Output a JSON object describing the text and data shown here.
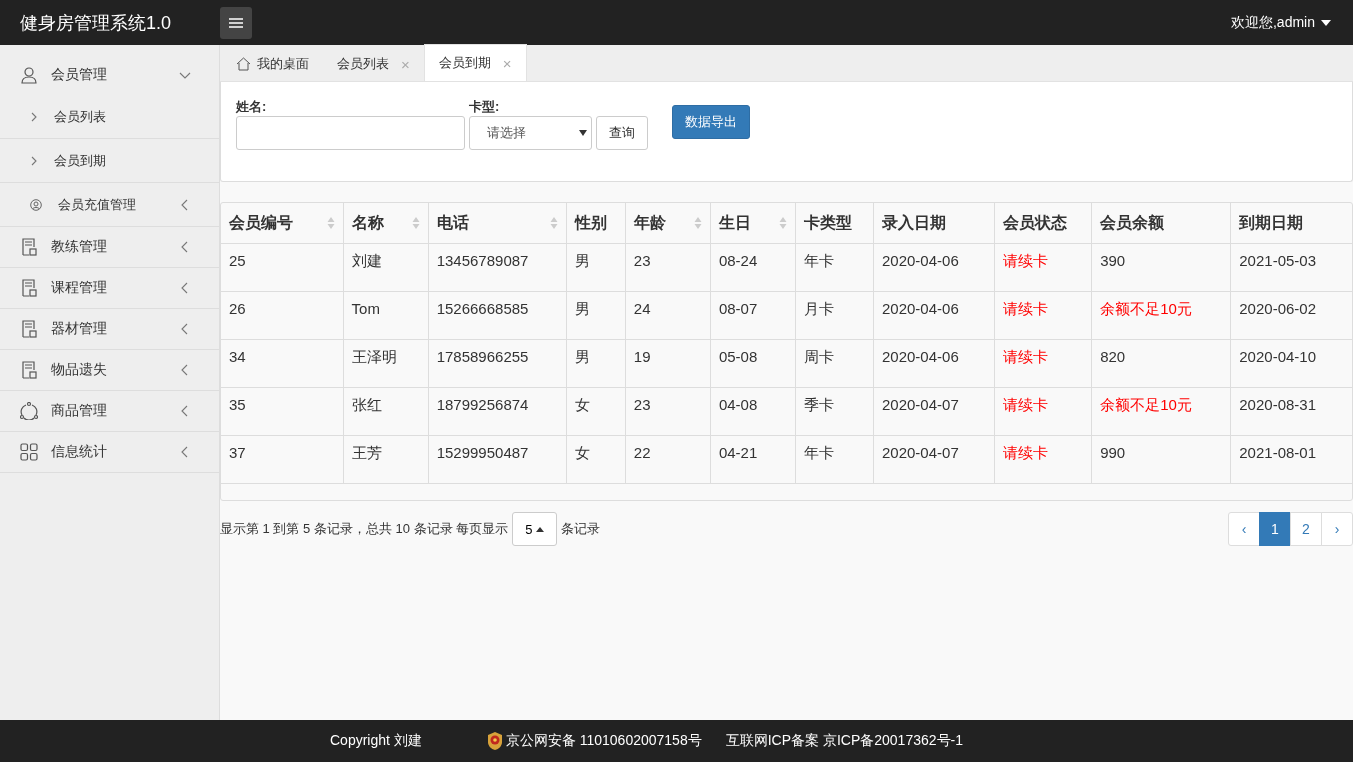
{
  "header": {
    "title": "健身房管理系统1.0",
    "user": "欢迎您,admin"
  },
  "sidebar": {
    "items": [
      {
        "label": "会员管理",
        "expanded": true,
        "children": [
          {
            "label": "会员列表",
            "kind": "link"
          },
          {
            "label": "会员到期",
            "kind": "link"
          },
          {
            "label": "会员充值管理",
            "kind": "group"
          }
        ]
      },
      {
        "label": "教练管理",
        "expanded": false
      },
      {
        "label": "课程管理",
        "expanded": false
      },
      {
        "label": "器材管理",
        "expanded": false
      },
      {
        "label": "物品遗失",
        "expanded": false
      },
      {
        "label": "商品管理",
        "expanded": false
      },
      {
        "label": "信息统计",
        "expanded": false
      }
    ]
  },
  "tabs": [
    {
      "label": "我的桌面",
      "selected": false
    },
    {
      "label": "会员列表",
      "close": "×",
      "selected": false
    },
    {
      "label": "会员到期",
      "close": "×",
      "selected": true
    }
  ],
  "search": {
    "name_label": "姓名:",
    "card_label": "卡型:",
    "card_placeholder": "请选择",
    "query_button": "查询",
    "export_button": "数据导出"
  },
  "table": {
    "columns": [
      {
        "label": "会员编号",
        "sortable": true
      },
      {
        "label": "名称",
        "sortable": true
      },
      {
        "label": "电话",
        "sortable": true
      },
      {
        "label": "性别",
        "sortable": false
      },
      {
        "label": "年龄",
        "sortable": true
      },
      {
        "label": "生日",
        "sortable": true
      },
      {
        "label": "卡类型",
        "sortable": false
      },
      {
        "label": "录入日期",
        "sortable": false
      },
      {
        "label": "会员状态",
        "sortable": false
      },
      {
        "label": "会员余额",
        "sortable": false
      },
      {
        "label": "到期日期",
        "sortable": false
      }
    ],
    "rows": [
      [
        {
          "text": "25",
          "alert": false
        },
        {
          "text": "刘建",
          "alert": false
        },
        {
          "text": "13456789087",
          "alert": false
        },
        {
          "text": "男",
          "alert": false
        },
        {
          "text": "23",
          "alert": false
        },
        {
          "text": "08-24",
          "alert": false
        },
        {
          "text": "年卡",
          "alert": false
        },
        {
          "text": "2020-04-06",
          "alert": false
        },
        {
          "text": "请续卡",
          "alert": true
        },
        {
          "text": "390",
          "alert": false
        },
        {
          "text": "2021-05-03",
          "alert": false
        }
      ],
      [
        {
          "text": "26",
          "alert": false
        },
        {
          "text": "Tom",
          "alert": false
        },
        {
          "text": "15266668585",
          "alert": false
        },
        {
          "text": "男",
          "alert": false
        },
        {
          "text": "24",
          "alert": false
        },
        {
          "text": "08-07",
          "alert": false
        },
        {
          "text": "月卡",
          "alert": false
        },
        {
          "text": "2020-04-06",
          "alert": false
        },
        {
          "text": "请续卡",
          "alert": true
        },
        {
          "text": "余额不足10元",
          "alert": true
        },
        {
          "text": "2020-06-02",
          "alert": false
        }
      ],
      [
        {
          "text": "34",
          "alert": false
        },
        {
          "text": "王泽明",
          "alert": false
        },
        {
          "text": "17858966255",
          "alert": false
        },
        {
          "text": "男",
          "alert": false
        },
        {
          "text": "19",
          "alert": false
        },
        {
          "text": "05-08",
          "alert": false
        },
        {
          "text": "周卡",
          "alert": false
        },
        {
          "text": "2020-04-06",
          "alert": false
        },
        {
          "text": "请续卡",
          "alert": true
        },
        {
          "text": "820",
          "alert": false
        },
        {
          "text": "2020-04-10",
          "alert": false
        }
      ],
      [
        {
          "text": "35",
          "alert": false
        },
        {
          "text": "张红",
          "alert": false
        },
        {
          "text": "18799256874",
          "alert": false
        },
        {
          "text": "女",
          "alert": false
        },
        {
          "text": "23",
          "alert": false
        },
        {
          "text": "04-08",
          "alert": false
        },
        {
          "text": "季卡",
          "alert": false
        },
        {
          "text": "2020-04-07",
          "alert": false
        },
        {
          "text": "请续卡",
          "alert": true
        },
        {
          "text": "余额不足10元",
          "alert": true
        },
        {
          "text": "2020-08-31",
          "alert": false
        }
      ],
      [
        {
          "text": "37",
          "alert": false
        },
        {
          "text": "王芳",
          "alert": false
        },
        {
          "text": "15299950487",
          "alert": false
        },
        {
          "text": "女",
          "alert": false
        },
        {
          "text": "22",
          "alert": false
        },
        {
          "text": "04-21",
          "alert": false
        },
        {
          "text": "年卡",
          "alert": false
        },
        {
          "text": "2020-04-07",
          "alert": false
        },
        {
          "text": "请续卡",
          "alert": true
        },
        {
          "text": "990",
          "alert": false
        },
        {
          "text": "2021-08-01",
          "alert": false
        }
      ]
    ]
  },
  "pagination": {
    "summary": "显示第 1 到第 5 条记录，总共 10 条记录 每页显示",
    "page_size": "5",
    "suffix": "条记录",
    "pages": [
      {
        "label": "‹",
        "selected": false
      },
      {
        "label": "1",
        "selected": true
      },
      {
        "label": "2",
        "selected": false
      },
      {
        "label": "›",
        "selected": false
      }
    ]
  },
  "footer": {
    "copyright": "Copyright 刘建",
    "police": "京公网安备 11010602007158号",
    "icp": "互联网ICP备案 京ICP备20017362号-1"
  }
}
